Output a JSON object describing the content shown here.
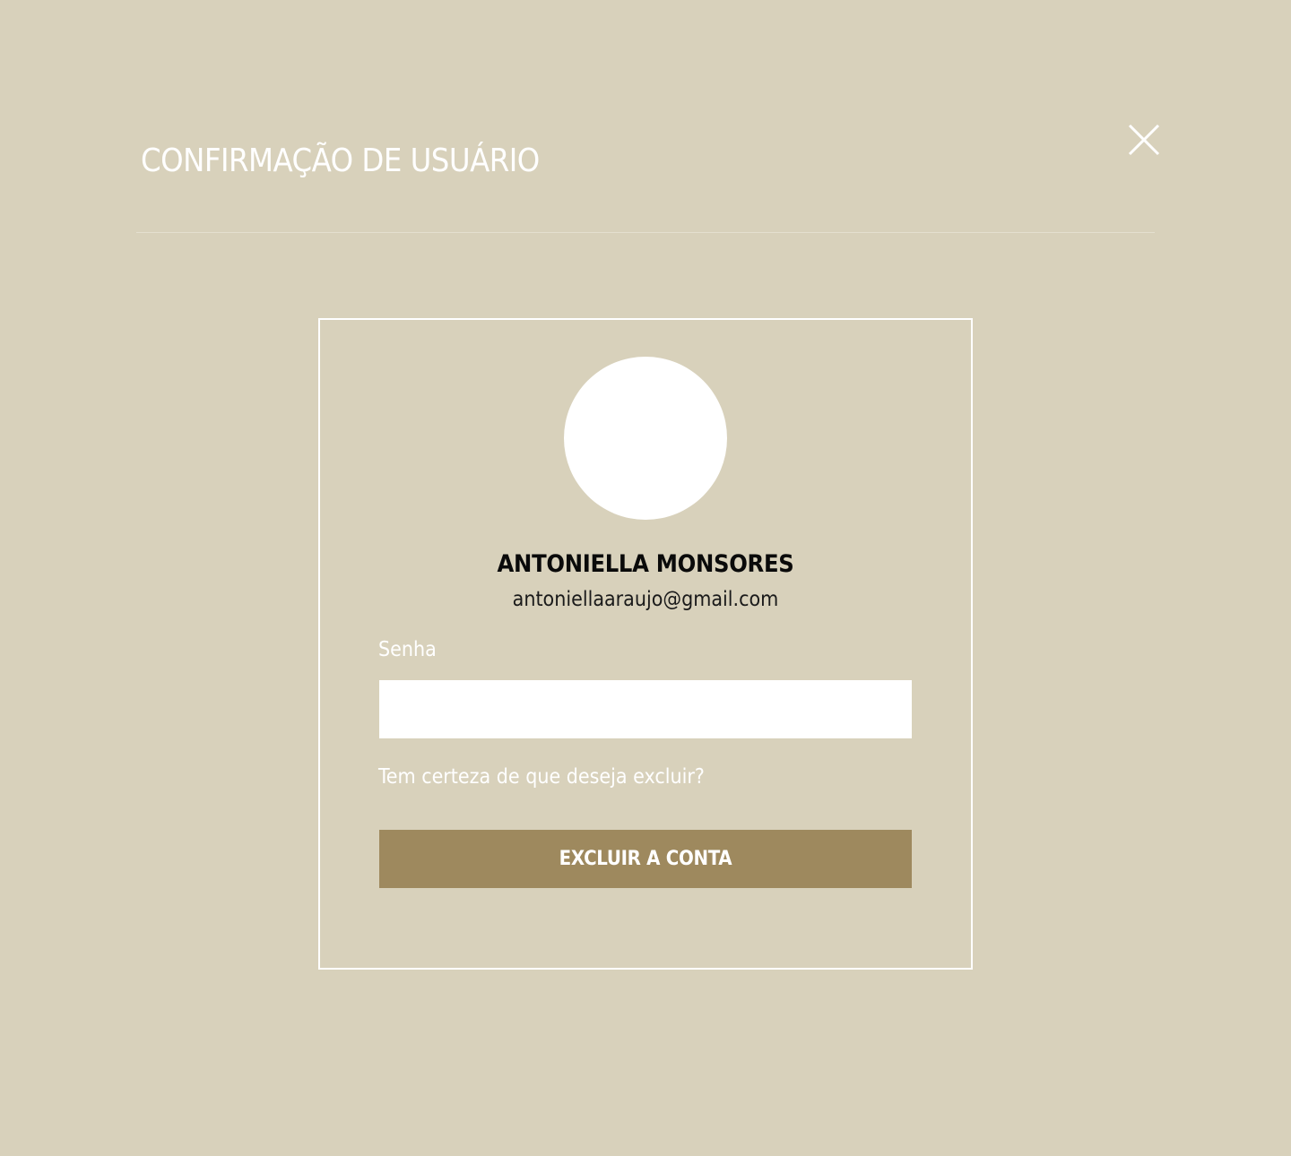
{
  "header": {
    "title": "CONFIRMAÇÃO DE USUÁRIO",
    "close_icon": "close-icon"
  },
  "user": {
    "name": "ANTONIELLA MONSORES",
    "email": "antoniellaaraujo@gmail.com",
    "avatar_icon": "avatar"
  },
  "form": {
    "password_label": "Senha",
    "password_value": "",
    "question": "Tem certeza de que deseja excluir?",
    "delete_button_label": "EXCLUIR A CONTA"
  },
  "colors": {
    "background": "#d8d1bb",
    "button": "#9e895e",
    "card_border": "#ffffff",
    "text_light": "#ffffff",
    "text_dark": "#0a0a0a"
  }
}
